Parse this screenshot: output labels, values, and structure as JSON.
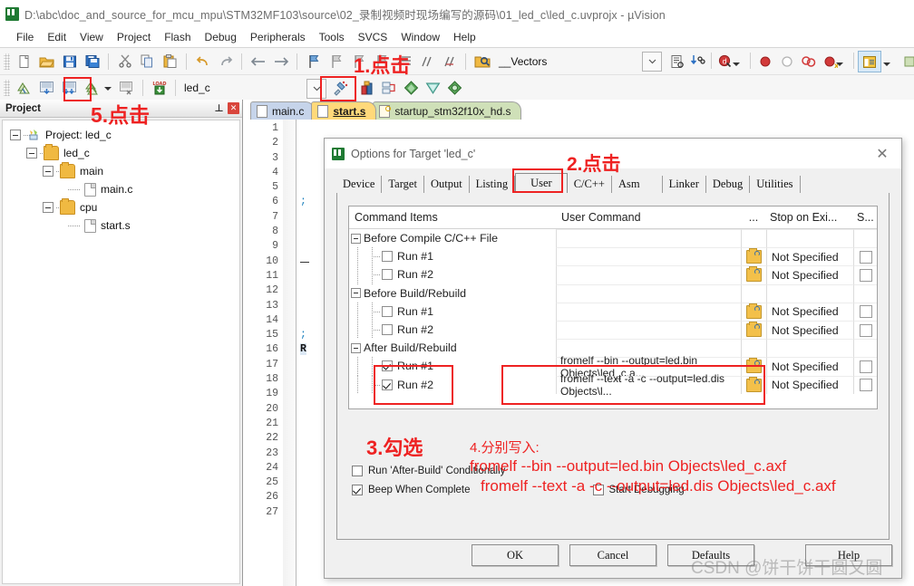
{
  "window": {
    "title": "D:\\abc\\doc_and_source_for_mcu_mpu\\STM32MF103\\source\\02_录制视频时现场编写的源码\\01_led_c\\led_c.uvprojx - µVision",
    "app_icon": "keil-uvision-icon"
  },
  "menubar": {
    "items": [
      "File",
      "Edit",
      "View",
      "Project",
      "Flash",
      "Debug",
      "Peripherals",
      "Tools",
      "SVCS",
      "Window",
      "Help"
    ]
  },
  "toolbar1": {
    "icons": [
      "new-file-icon",
      "open-file-icon",
      "save-icon",
      "save-all-icon",
      "cut-icon",
      "copy-icon",
      "paste-icon",
      "undo-icon",
      "redo-icon",
      "navigate-back-icon",
      "navigate-forward-icon",
      "bookmark-toggle-icon",
      "bookmark-prev-icon",
      "bookmark-next-icon",
      "indent-icon",
      "comment-icon",
      "uncomment-icon",
      "browse-icon"
    ],
    "vectors_value": "__Vectors",
    "right_icons": [
      "function-list-icon",
      "find-in-files-icon",
      "debug-start-icon",
      "breakpoint-icon",
      "breakpoint-disabled-icon",
      "breakpoint-disable-all-icon",
      "breakpoint-kill-all-icon",
      "window-layout-icon"
    ]
  },
  "toolbar2": {
    "icons": [
      "translate-icon",
      "build-icon",
      "rebuild-icon",
      "batch-build-icon",
      "stop-build-icon",
      "download-icon"
    ],
    "target_value": "led_c",
    "right_icons": [
      "options-target-icon",
      "manage-project-items-icon",
      "multi-project-icon",
      "pack-installer-icon",
      "manage-runtime-icon",
      "svcs-icon"
    ]
  },
  "project_panel": {
    "header": "Project",
    "pin_icon": "pin-icon",
    "close_icon": "close-icon",
    "tree": [
      {
        "label": "Project: led_c",
        "icon": "project-icon",
        "depth": 0
      },
      {
        "label": "led_c",
        "icon": "target-icon",
        "depth": 1
      },
      {
        "label": "main",
        "icon": "folder-icon",
        "depth": 2
      },
      {
        "label": "main.c",
        "icon": "c-file-icon",
        "depth": 3
      },
      {
        "label": "cpu",
        "icon": "folder-icon",
        "depth": 2
      },
      {
        "label": "start.s",
        "icon": "asm-file-icon",
        "depth": 3
      }
    ]
  },
  "editor": {
    "tabs": [
      {
        "label": "main.c",
        "icon": "c-file-icon",
        "active": false,
        "style": "main"
      },
      {
        "label": "start.s",
        "icon": "asm-file-icon",
        "active": true,
        "style": "active"
      },
      {
        "label": "startup_stm32f10x_hd.s",
        "icon": "asm-readonly-file-icon",
        "active": false,
        "style": "startup"
      }
    ],
    "line_numbers": [
      1,
      2,
      3,
      4,
      5,
      6,
      7,
      8,
      9,
      10,
      11,
      12,
      13,
      14,
      15,
      16,
      17,
      18,
      19,
      20,
      21,
      22,
      23,
      24,
      25,
      26,
      27
    ],
    "code_fragments": {
      "line6": ";",
      "line15": ";",
      "line16": "R"
    }
  },
  "dialog": {
    "title": "Options for Target 'led_c'",
    "icon": "keil-uvision-icon",
    "close_icon": "close-icon",
    "tabs": [
      {
        "label": "Device",
        "selected": false
      },
      {
        "label": "Target",
        "selected": false
      },
      {
        "label": "Output",
        "selected": false
      },
      {
        "label": "Listing",
        "selected": false
      },
      {
        "label": "User",
        "selected": true
      },
      {
        "label": "C/C++",
        "selected": false
      },
      {
        "label": "Asm",
        "selected": false
      },
      {
        "label": "Linker",
        "selected": false
      },
      {
        "label": "Debug",
        "selected": false
      },
      {
        "label": "Utilities",
        "selected": false
      }
    ],
    "grid": {
      "headers": [
        "Command Items",
        "User Command",
        "...",
        "Stop on Exi...",
        "S..."
      ],
      "rows": [
        {
          "type": "group",
          "label": "Before Compile C/C++ File",
          "checked": null,
          "command": "",
          "stop": "",
          "has_folder": false,
          "has_check": false
        },
        {
          "type": "item",
          "label": "Run #1",
          "checked": false,
          "command": "",
          "stop": "Not Specified",
          "has_folder": true,
          "has_check": true
        },
        {
          "type": "item",
          "label": "Run #2",
          "checked": false,
          "command": "",
          "stop": "Not Specified",
          "has_folder": true,
          "has_check": true
        },
        {
          "type": "group",
          "label": "Before Build/Rebuild",
          "checked": null,
          "command": "",
          "stop": "",
          "has_folder": false,
          "has_check": false
        },
        {
          "type": "item",
          "label": "Run #1",
          "checked": false,
          "command": "",
          "stop": "Not Specified",
          "has_folder": true,
          "has_check": true
        },
        {
          "type": "item",
          "label": "Run #2",
          "checked": false,
          "command": "",
          "stop": "Not Specified",
          "has_folder": true,
          "has_check": true
        },
        {
          "type": "group",
          "label": "After Build/Rebuild",
          "checked": null,
          "command": "",
          "stop": "",
          "has_folder": false,
          "has_check": false
        },
        {
          "type": "item",
          "label": "Run #1",
          "checked": true,
          "command": "fromelf  --bin  --output=led.bin  Objects\\led_c.a...",
          "stop": "Not Specified",
          "has_folder": true,
          "has_check": true
        },
        {
          "type": "item",
          "label": "Run #2",
          "checked": true,
          "command": "fromelf  --text  -a -c  --output=led.dis  Objects\\l...",
          "stop": "Not Specified",
          "has_folder": true,
          "has_check": true
        }
      ]
    },
    "options": [
      {
        "label": "Run 'After-Build' Conditionally",
        "checked": false
      },
      {
        "label": "Beep When Complete",
        "checked": true
      },
      {
        "label": "Start Debugging",
        "checked": false
      }
    ],
    "buttons": [
      {
        "label": "OK"
      },
      {
        "label": "Cancel"
      },
      {
        "label": "Defaults"
      },
      {
        "label": "Help"
      }
    ]
  },
  "annotations": {
    "step1": "1.点击",
    "step2": "2.点击",
    "step3": "3.勾选",
    "step4_label": "4.分别写入:",
    "step4_line1": "fromelf  --bin  --output=led.bin  Objects\\led_c.axf",
    "step4_line2": "fromelf  --text  -a -c  --output=led.dis  Objects\\led_c.axf",
    "step5": "5.点击",
    "color": "#ee2222"
  },
  "watermark": {
    "text": "CSDN @饼干饼干圆又圆"
  }
}
